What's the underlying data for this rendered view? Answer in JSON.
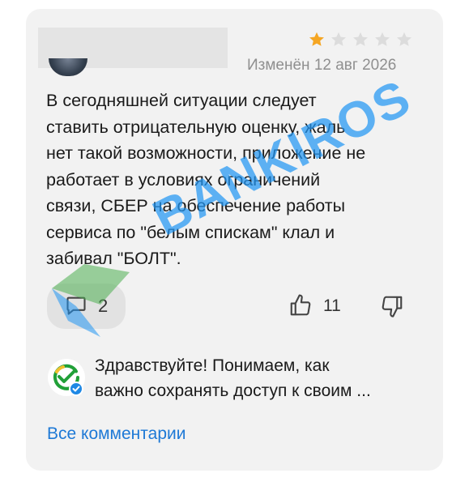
{
  "review": {
    "rating": 1,
    "max_rating": 5,
    "date": "Изменён 12 авг 2026",
    "text": "В сегодняшней ситуации следует\nставить отрицательную оценку, жаль\nнет такой возможности, приложение не\nработает в условиях ограничений\nсвязи,  СБЕР на обеспечение работы\nсервиса по \"белым спискам\" клал и\nзабивал \"БОЛТ\"."
  },
  "actions": {
    "comments_count": "2",
    "likes_count": "11"
  },
  "reply": {
    "text": "Здравствуйте! Понимаем, как\nважно сохранять доступ к своим ..."
  },
  "links": {
    "all_comments": "Все комментарии"
  },
  "watermark": {
    "text": "BANKIROS"
  },
  "colors": {
    "star_filled": "#f5a623",
    "star_empty": "#dcdcdc",
    "link": "#1e79d6",
    "watermark": "#2196f3"
  },
  "icons": {
    "comment": "speech-bubble-icon",
    "like": "thumbs-up-icon",
    "dislike": "thumbs-down-icon",
    "reply_logo": "sber-logo-icon"
  }
}
